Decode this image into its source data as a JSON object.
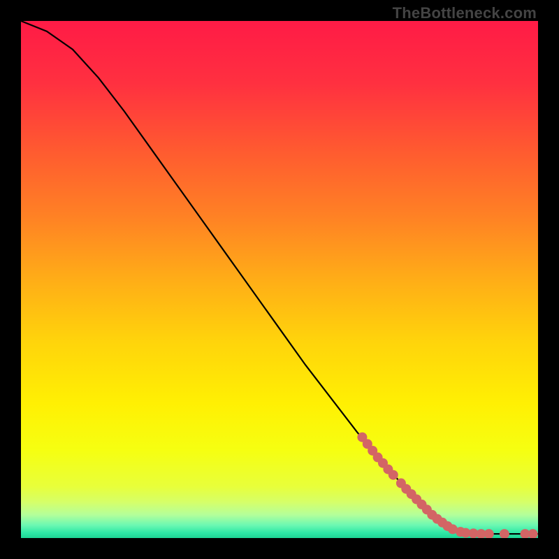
{
  "watermark": "TheBottleneck.com",
  "chart_data": {
    "type": "line",
    "title": "",
    "xlabel": "",
    "ylabel": "",
    "xlim": [
      0,
      100
    ],
    "ylim": [
      0,
      100
    ],
    "grid": false,
    "curve": [
      {
        "x": 0,
        "y": 100
      },
      {
        "x": 5,
        "y": 98
      },
      {
        "x": 10,
        "y": 94.5
      },
      {
        "x": 15,
        "y": 89
      },
      {
        "x": 20,
        "y": 82.5
      },
      {
        "x": 25,
        "y": 75.5
      },
      {
        "x": 30,
        "y": 68.5
      },
      {
        "x": 35,
        "y": 61.5
      },
      {
        "x": 40,
        "y": 54.5
      },
      {
        "x": 45,
        "y": 47.5
      },
      {
        "x": 50,
        "y": 40.5
      },
      {
        "x": 55,
        "y": 33.5
      },
      {
        "x": 60,
        "y": 27
      },
      {
        "x": 65,
        "y": 20.5
      },
      {
        "x": 70,
        "y": 14.5
      },
      {
        "x": 75,
        "y": 9
      },
      {
        "x": 80,
        "y": 4
      },
      {
        "x": 84,
        "y": 1.3
      },
      {
        "x": 88,
        "y": 0.8
      },
      {
        "x": 92,
        "y": 0.8
      },
      {
        "x": 96,
        "y": 0.8
      },
      {
        "x": 100,
        "y": 0.8
      }
    ],
    "markers": [
      {
        "x": 66,
        "y": 19.5
      },
      {
        "x": 67,
        "y": 18.2
      },
      {
        "x": 68,
        "y": 16.9
      },
      {
        "x": 69,
        "y": 15.6
      },
      {
        "x": 70,
        "y": 14.5
      },
      {
        "x": 71,
        "y": 13.3
      },
      {
        "x": 72,
        "y": 12.2
      },
      {
        "x": 73.5,
        "y": 10.6
      },
      {
        "x": 74.5,
        "y": 9.5
      },
      {
        "x": 75.5,
        "y": 8.5
      },
      {
        "x": 76.5,
        "y": 7.5
      },
      {
        "x": 77.5,
        "y": 6.5
      },
      {
        "x": 78.5,
        "y": 5.5
      },
      {
        "x": 79.5,
        "y": 4.5
      },
      {
        "x": 80.5,
        "y": 3.7
      },
      {
        "x": 81.5,
        "y": 3.0
      },
      {
        "x": 82.5,
        "y": 2.3
      },
      {
        "x": 83.5,
        "y": 1.7
      },
      {
        "x": 85,
        "y": 1.2
      },
      {
        "x": 86,
        "y": 1.0
      },
      {
        "x": 87.5,
        "y": 0.9
      },
      {
        "x": 89,
        "y": 0.8
      },
      {
        "x": 90.5,
        "y": 0.8
      },
      {
        "x": 93.5,
        "y": 0.8
      },
      {
        "x": 97.5,
        "y": 0.8
      },
      {
        "x": 99,
        "y": 0.8
      }
    ],
    "marker_color": "#d36565",
    "curve_color": "#000000",
    "gradient_stops": [
      {
        "offset": 0.0,
        "color": "#ff1b46"
      },
      {
        "offset": 0.12,
        "color": "#ff3040"
      },
      {
        "offset": 0.25,
        "color": "#ff5a30"
      },
      {
        "offset": 0.38,
        "color": "#ff8224"
      },
      {
        "offset": 0.5,
        "color": "#ffad17"
      },
      {
        "offset": 0.62,
        "color": "#ffd40b"
      },
      {
        "offset": 0.74,
        "color": "#fff003"
      },
      {
        "offset": 0.83,
        "color": "#f6ff11"
      },
      {
        "offset": 0.9,
        "color": "#e8ff3a"
      },
      {
        "offset": 0.93,
        "color": "#d6ff68"
      },
      {
        "offset": 0.955,
        "color": "#b4ff9a"
      },
      {
        "offset": 0.975,
        "color": "#6cf8b2"
      },
      {
        "offset": 0.99,
        "color": "#2ee8a6"
      },
      {
        "offset": 1.0,
        "color": "#1ed494"
      }
    ]
  }
}
